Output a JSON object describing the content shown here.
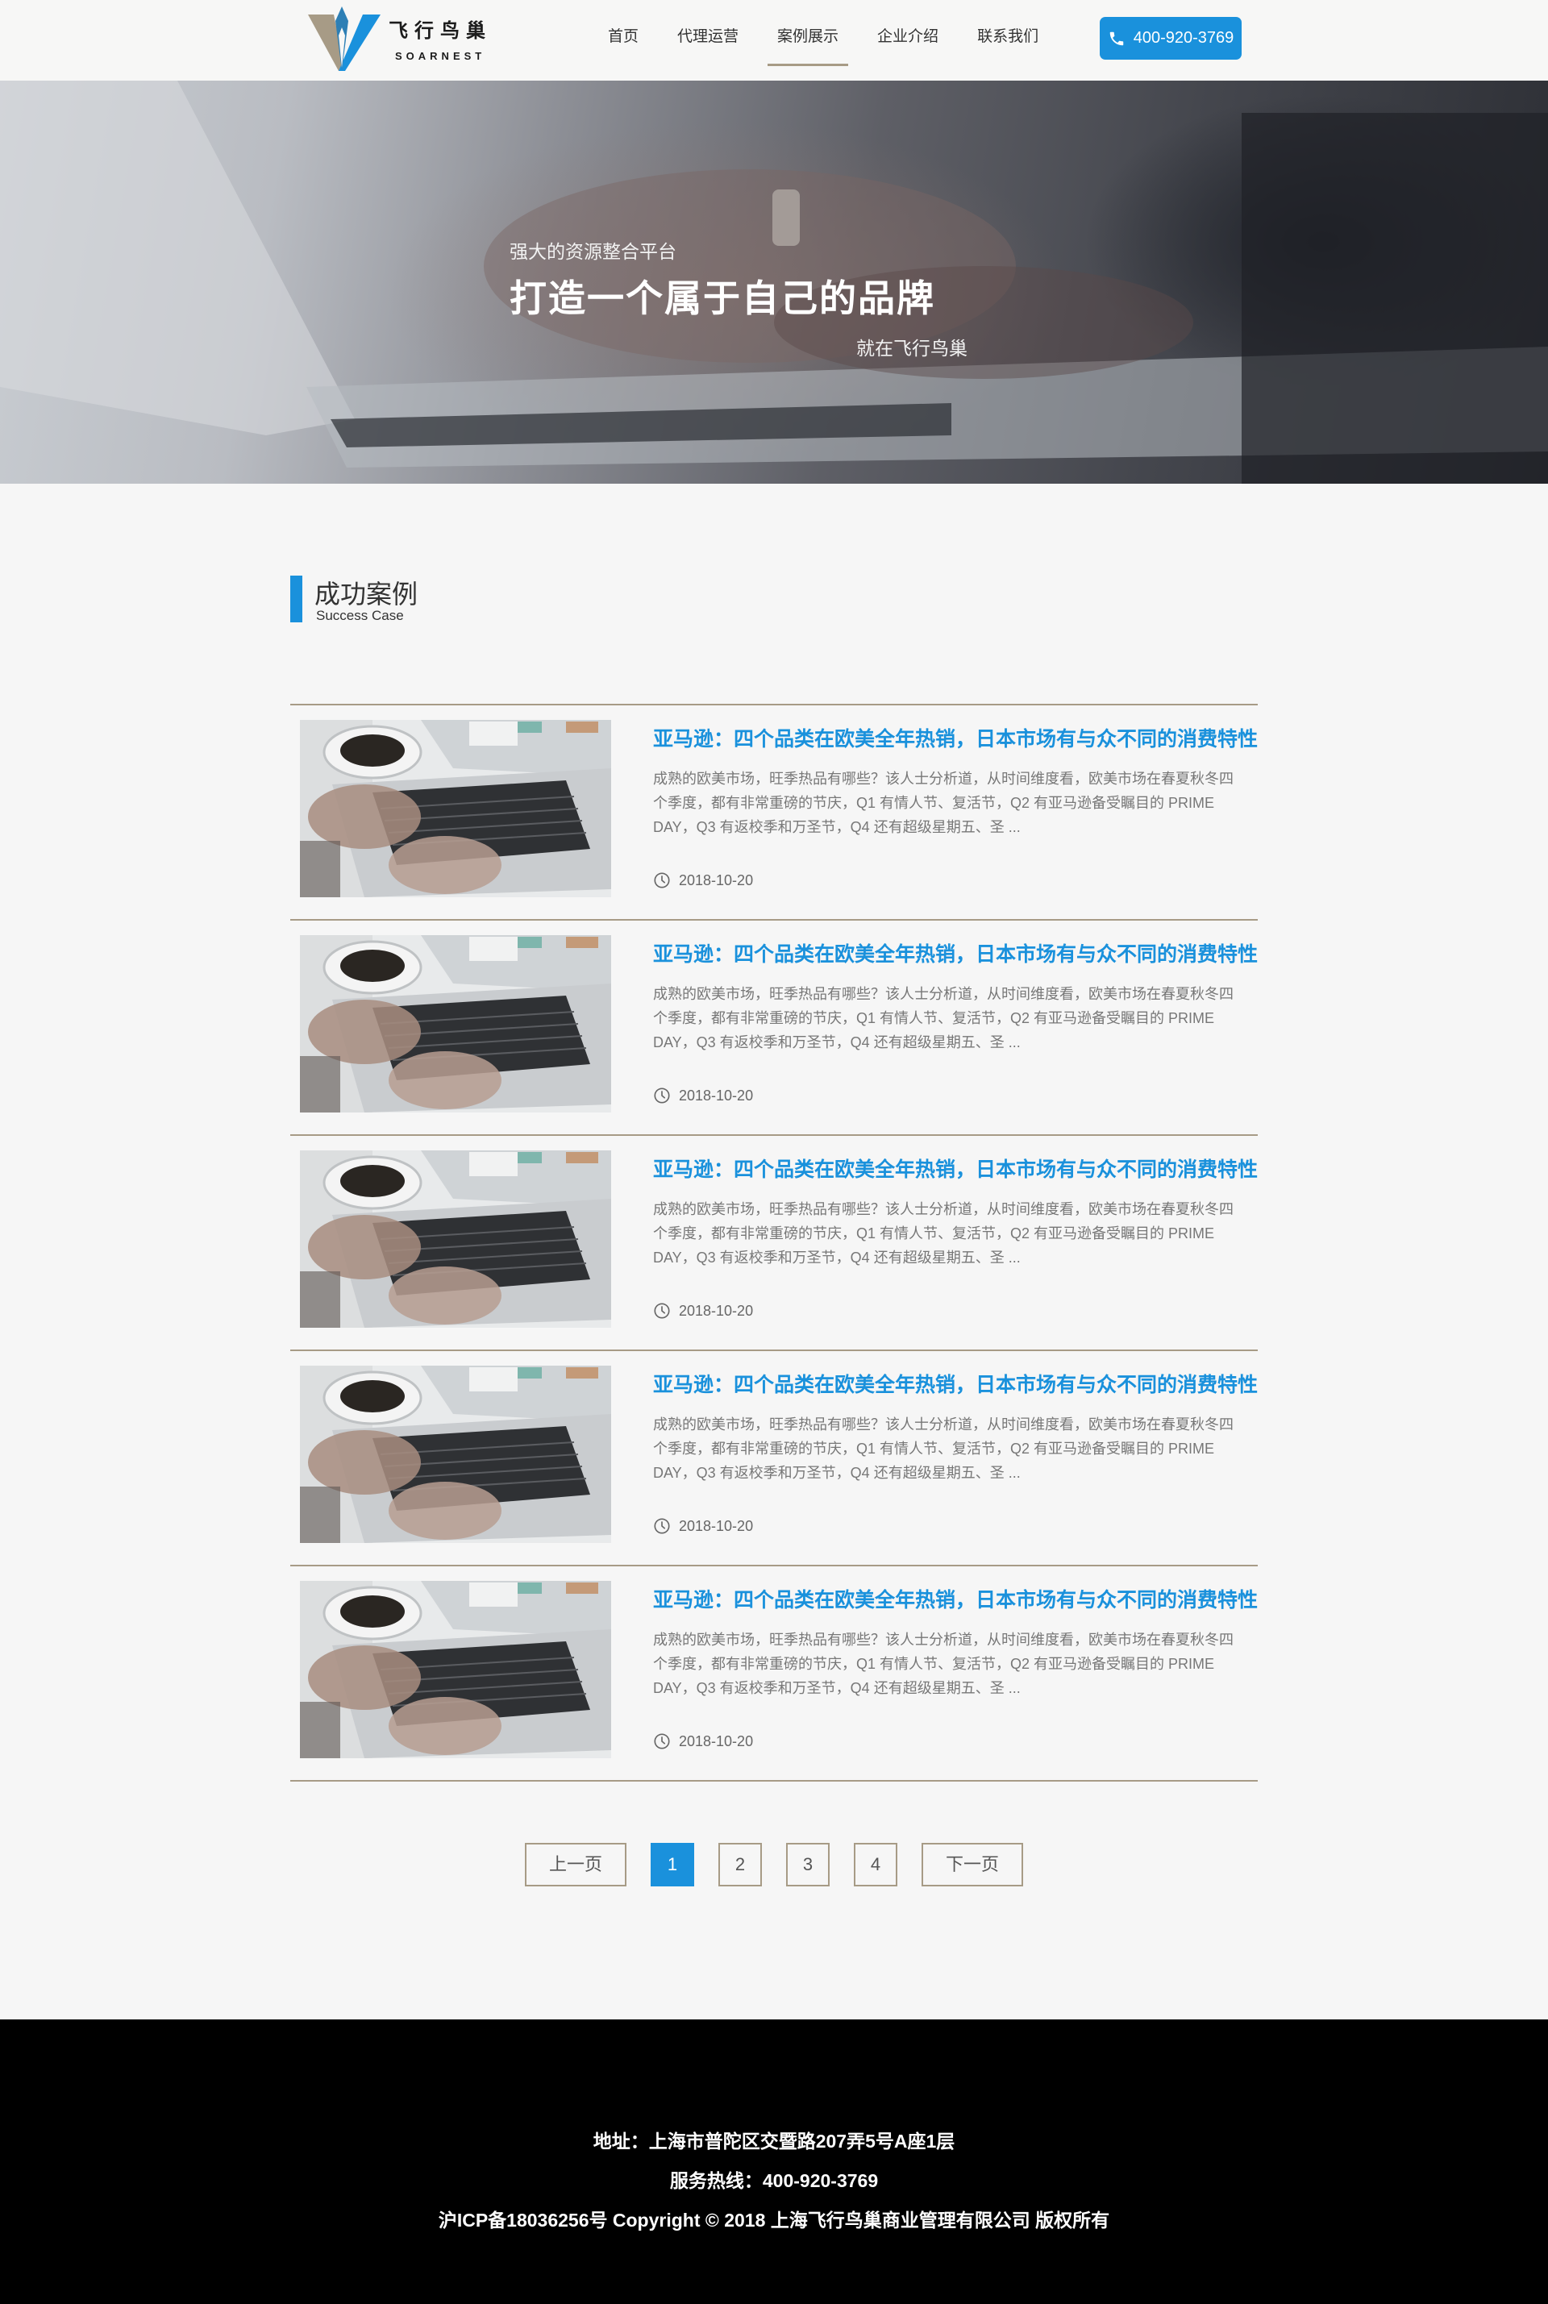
{
  "header": {
    "logo": {
      "cn": "飞行鸟巢",
      "en": "SOARNEST"
    },
    "nav": [
      {
        "label": "首页",
        "active": false
      },
      {
        "label": "代理运营",
        "active": false
      },
      {
        "label": "案例展示",
        "active": true
      },
      {
        "label": "企业介绍",
        "active": false
      },
      {
        "label": "联系我们",
        "active": false
      }
    ],
    "phone": "400-920-3769"
  },
  "banner": {
    "subtitle": "强大的资源整合平台",
    "title": "打造一个属于自己的品牌",
    "tail": "就在飞行鸟巢"
  },
  "section": {
    "title": "成功案例",
    "subtitle": "Success Case"
  },
  "cases": [
    {
      "title": "亚马逊：四个品类在欧美全年热销，日本市场有与众不同的消费特性",
      "desc": "成熟的欧美市场，旺季热品有哪些？该人士分析道，从时间维度看，欧美市场在春夏秋冬四个季度，都有非常重磅的节庆，Q1 有情人节、复活节，Q2 有亚马逊备受瞩目的 PRIME DAY，Q3 有返校季和万圣节，Q4 还有超级星期五、圣 ...",
      "date": "2018-10-20"
    },
    {
      "title": "亚马逊：四个品类在欧美全年热销，日本市场有与众不同的消费特性",
      "desc": "成熟的欧美市场，旺季热品有哪些？该人士分析道，从时间维度看，欧美市场在春夏秋冬四个季度，都有非常重磅的节庆，Q1 有情人节、复活节，Q2 有亚马逊备受瞩目的 PRIME DAY，Q3 有返校季和万圣节，Q4 还有超级星期五、圣 ...",
      "date": "2018-10-20"
    },
    {
      "title": "亚马逊：四个品类在欧美全年热销，日本市场有与众不同的消费特性",
      "desc": "成熟的欧美市场，旺季热品有哪些？该人士分析道，从时间维度看，欧美市场在春夏秋冬四个季度，都有非常重磅的节庆，Q1 有情人节、复活节，Q2 有亚马逊备受瞩目的 PRIME DAY，Q3 有返校季和万圣节，Q4 还有超级星期五、圣 ...",
      "date": "2018-10-20"
    },
    {
      "title": "亚马逊：四个品类在欧美全年热销，日本市场有与众不同的消费特性",
      "desc": "成熟的欧美市场，旺季热品有哪些？该人士分析道，从时间维度看，欧美市场在春夏秋冬四个季度，都有非常重磅的节庆，Q1 有情人节、复活节，Q2 有亚马逊备受瞩目的 PRIME DAY，Q3 有返校季和万圣节，Q4 还有超级星期五、圣 ...",
      "date": "2018-10-20"
    },
    {
      "title": "亚马逊：四个品类在欧美全年热销，日本市场有与众不同的消费特性",
      "desc": "成熟的欧美市场，旺季热品有哪些？该人士分析道，从时间维度看，欧美市场在春夏秋冬四个季度，都有非常重磅的节庆，Q1 有情人节、复活节，Q2 有亚马逊备受瞩目的 PRIME DAY，Q3 有返校季和万圣节，Q4 还有超级星期五、圣 ...",
      "date": "2018-10-20"
    }
  ],
  "pagination": {
    "prev": "上一页",
    "pages": [
      "1",
      "2",
      "3",
      "4"
    ],
    "current": "1",
    "next": "下一页"
  },
  "footer": {
    "address": "地址：上海市普陀区交暨路207弄5号A座1层",
    "hotline": "服务热线：400-920-3769",
    "copyright": "沪ICP备18036256号 Copyright © 2018 上海飞行鸟巢商业管理有限公司 版权所有"
  },
  "colors": {
    "accent": "#1a91dc",
    "divider": "#a79b86",
    "footer_bg": "#000000"
  },
  "icons": {
    "phone": "phone-icon",
    "clock": "clock-icon",
    "logo": "logo-mark-icon"
  }
}
